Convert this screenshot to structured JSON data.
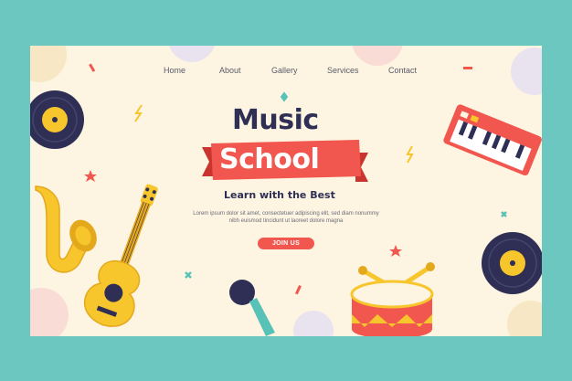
{
  "nav": {
    "items": [
      "Home",
      "About",
      "Gallery",
      "Services",
      "Contact"
    ]
  },
  "hero": {
    "title_line1": "Music",
    "title_line2": "School",
    "tagline": "Learn with the Best",
    "description": "Lorem ipsum dolor sit amet, consectetuer adipiscing elit, sed diam nonummy nibh euismod tincidunt ut laoreet dolore magna",
    "cta_label": "JOIN US"
  },
  "colors": {
    "frame": "#6cc7c0",
    "page_bg": "#fdf5e1",
    "accent": "#f2574f",
    "heading": "#2f2f55",
    "yellow": "#f7c52c",
    "teal": "#59c2b8"
  },
  "icons": [
    "vinyl-record-icon",
    "saxophone-icon",
    "guitar-icon",
    "microphone-icon",
    "drum-icon",
    "keyboard-icon",
    "sparkle-icon",
    "star-icon"
  ]
}
